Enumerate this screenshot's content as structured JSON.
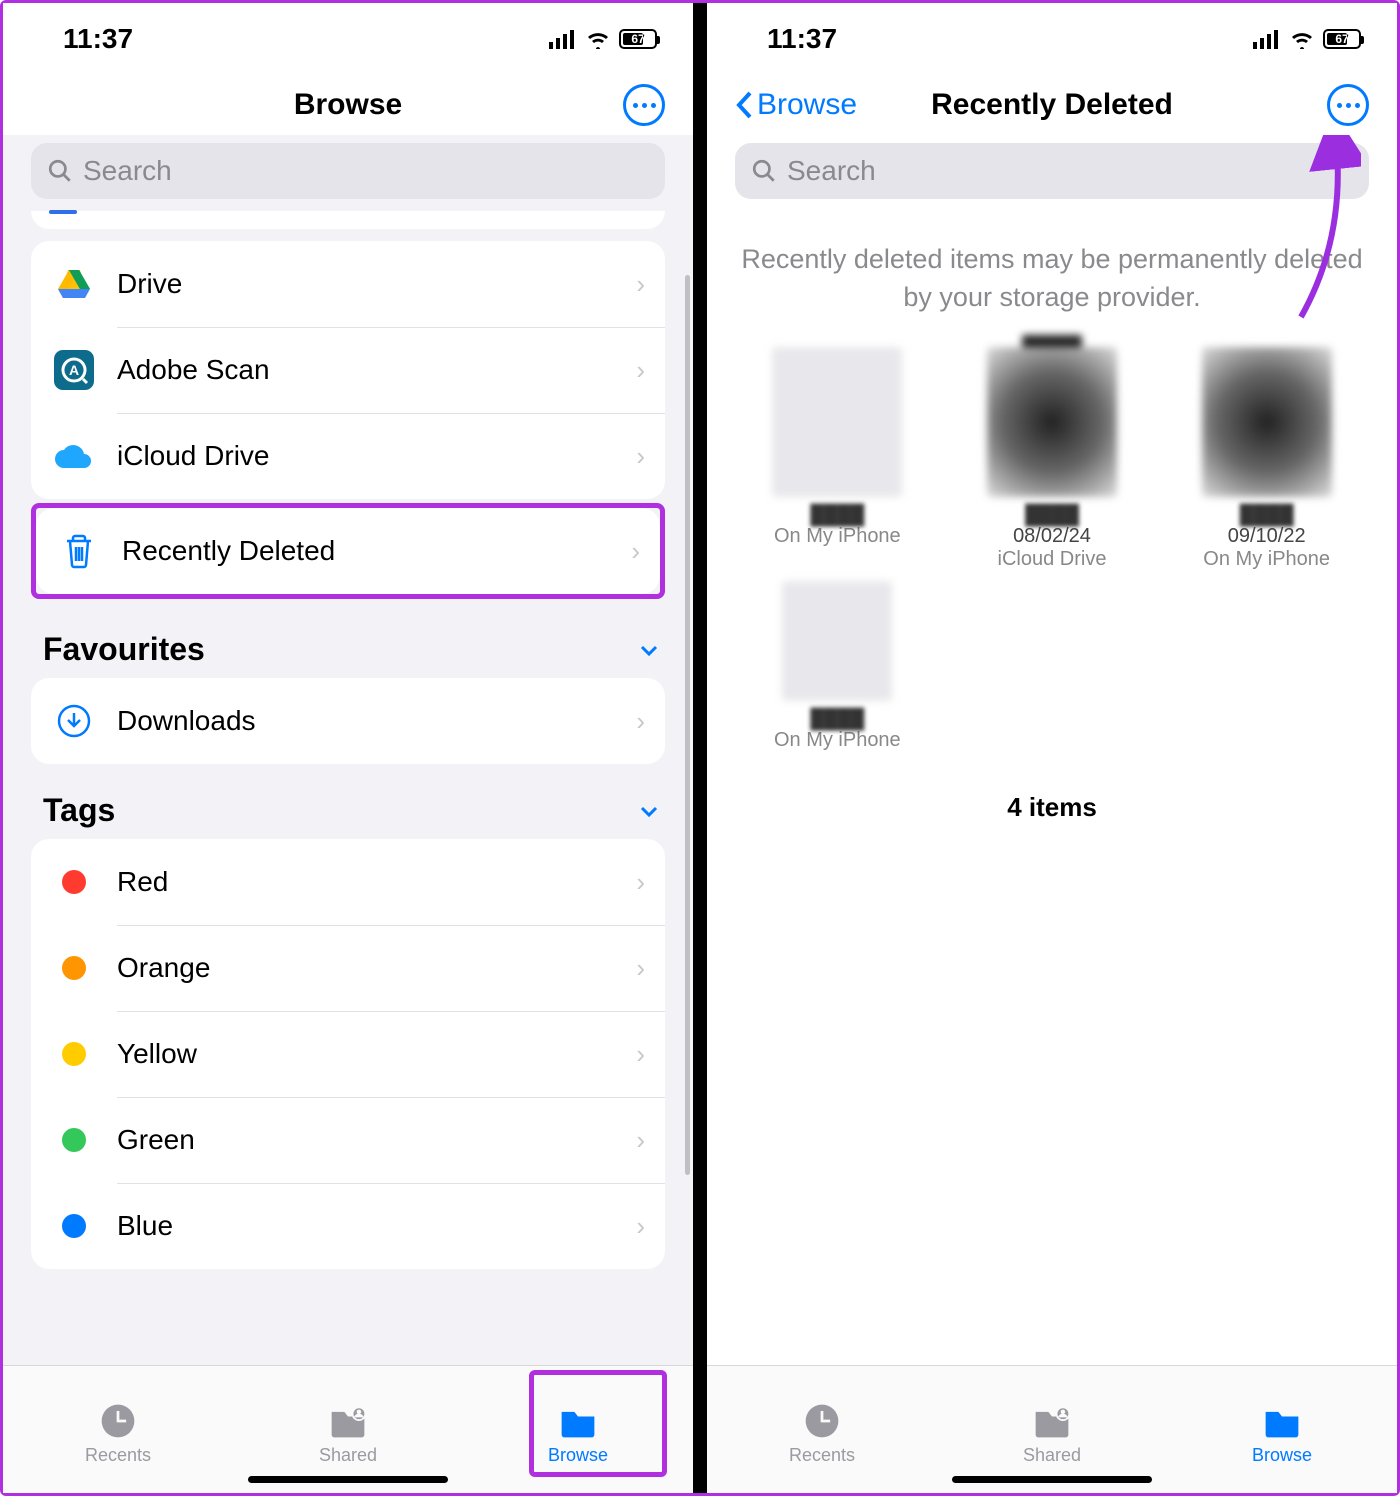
{
  "status": {
    "time": "11:37",
    "battery_pct": "67"
  },
  "left": {
    "title": "Browse",
    "search_placeholder": "Search",
    "locations": [
      {
        "id": "drive",
        "label": "Drive"
      },
      {
        "id": "adobe-scan",
        "label": "Adobe Scan"
      },
      {
        "id": "icloud-drive",
        "label": "iCloud Drive"
      },
      {
        "id": "recently-deleted",
        "label": "Recently Deleted"
      }
    ],
    "favourites_header": "Favourites",
    "favourites": [
      {
        "id": "downloads",
        "label": "Downloads"
      }
    ],
    "tags_header": "Tags",
    "tags": [
      {
        "label": "Red",
        "color": "#ff3b30"
      },
      {
        "label": "Orange",
        "color": "#ff9500"
      },
      {
        "label": "Yellow",
        "color": "#ffcc00"
      },
      {
        "label": "Green",
        "color": "#34c759"
      },
      {
        "label": "Blue",
        "color": "#007aff"
      }
    ]
  },
  "right": {
    "back_label": "Browse",
    "title": "Recently Deleted",
    "search_placeholder": "Search",
    "info_text": "Recently deleted items may be permanently deleted by your storage provider.",
    "items": [
      {
        "date": "",
        "loc": "On My iPhone"
      },
      {
        "date": "08/02/24",
        "loc": "iCloud Drive"
      },
      {
        "date": "09/10/22",
        "loc": "On My iPhone"
      },
      {
        "date": "",
        "loc": "On My iPhone"
      }
    ],
    "count_label": "4 items"
  },
  "tabs": [
    {
      "id": "recents",
      "label": "Recents"
    },
    {
      "id": "shared",
      "label": "Shared"
    },
    {
      "id": "browse",
      "label": "Browse"
    }
  ]
}
